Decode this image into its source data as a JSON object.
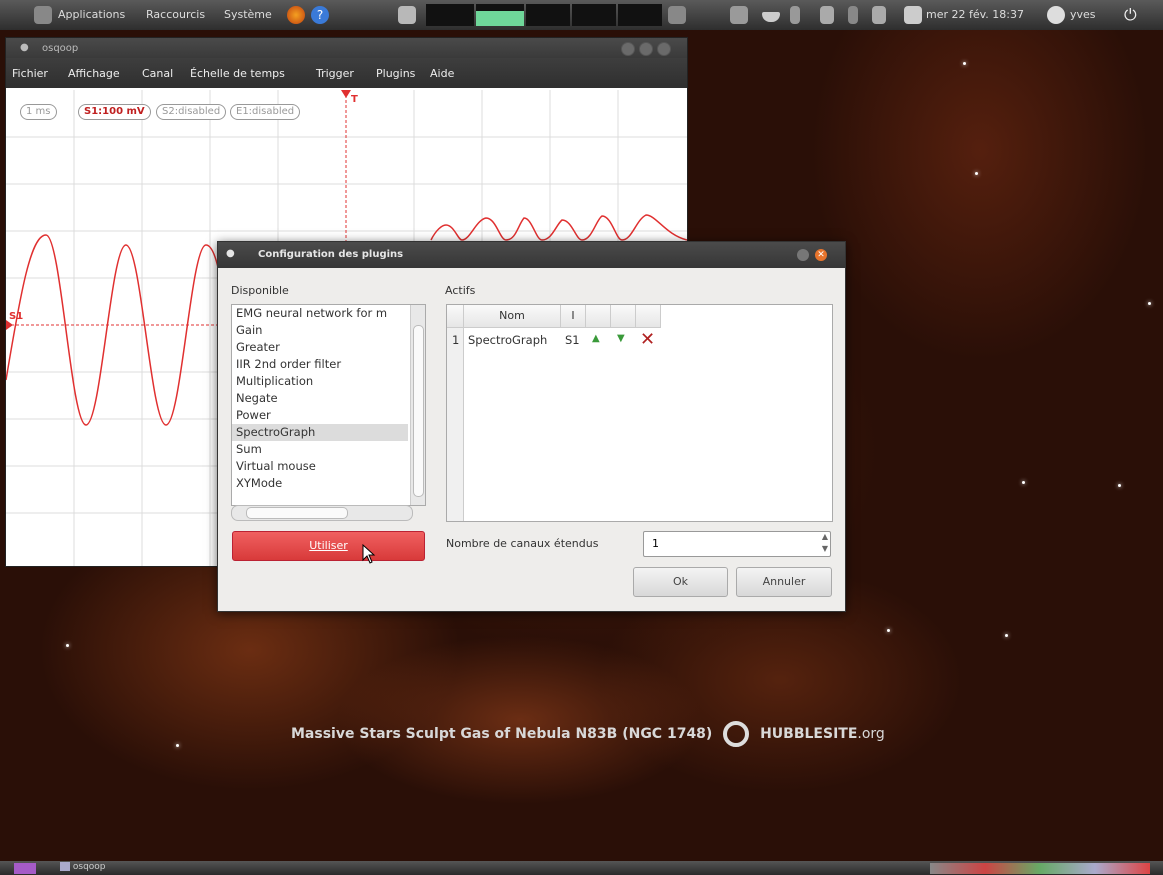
{
  "top_panel": {
    "menu_applications": "Applications",
    "menu_shortcuts": "Raccourcis",
    "menu_system": "Système",
    "clock": "mer 22 fév. 18:37",
    "user": "yves"
  },
  "osq_window": {
    "title": "osqoop",
    "menu": [
      "Fichier",
      "Affichage",
      "Canal",
      "Échelle de temps",
      "Trigger",
      "Plugins",
      "Aide"
    ],
    "time_scale": "1 ms",
    "s1_scale": "S1:100 mV",
    "s2": "S2:disabled",
    "e1": "E1:disabled",
    "trigger_label": "T",
    "channel_label": "S1"
  },
  "dialog": {
    "title": "Configuration des plugins",
    "available_label": "Disponible",
    "active_label": "Actifs",
    "available_items": [
      "EMG neural network for m",
      "Gain",
      "Greater",
      "IIR 2nd order filter",
      "Multiplication",
      "Negate",
      "Power",
      "SpectroGraph",
      "Sum",
      "Virtual mouse",
      "XYMode"
    ],
    "selected_item": "SpectroGraph",
    "use_button": "Utiliser",
    "table_headers": [
      "Nom",
      "I"
    ],
    "active_rows": [
      {
        "index": "1",
        "name": "SpectroGraph",
        "input": "S1"
      }
    ],
    "extended_channels_label": "Nombre de canaux étendus",
    "extended_channels_value": "1",
    "ok_button": "Ok",
    "cancel_button": "Annuler"
  },
  "wallpaper_caption": {
    "text": "Massive Stars Sculpt Gas of Nebula N83B (NGC 1748)",
    "brand": "HUBBLESITE",
    "brand_suffix": ".org"
  },
  "taskbar": {
    "window_button": "osqoop"
  },
  "colors": {
    "signal": "#e03030",
    "use_button": "#e84848",
    "panel": "#3a3a3a"
  }
}
